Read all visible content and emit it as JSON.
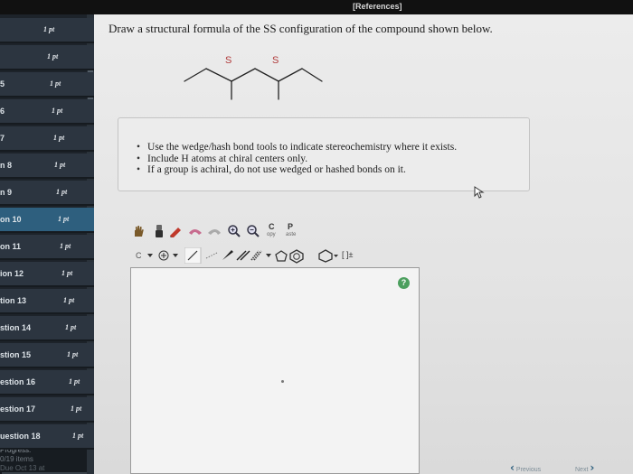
{
  "header": {
    "references_link": "[References]"
  },
  "sidebar": {
    "items": [
      {
        "label": "",
        "points": "1 pt"
      },
      {
        "label": "",
        "points": "1 pt"
      },
      {
        "label": "5",
        "points": "1 pt"
      },
      {
        "label": "6",
        "points": "1 pt"
      },
      {
        "label": "7",
        "points": "1 pt"
      },
      {
        "label": "n 8",
        "points": "1 pt"
      },
      {
        "label": "n 9",
        "points": "1 pt"
      },
      {
        "label": "on 10",
        "points": "1 pt"
      },
      {
        "label": "on 11",
        "points": "1 pt"
      },
      {
        "label": "ion 12",
        "points": "1 pt"
      },
      {
        "label": "tion 13",
        "points": "1 pt"
      },
      {
        "label": "stion 14",
        "points": "1 pt"
      },
      {
        "label": "stion 15",
        "points": "1 pt"
      },
      {
        "label": "estion 16",
        "points": "1 pt"
      },
      {
        "label": "estion 17",
        "points": "1 pt"
      },
      {
        "label": "uestion 18",
        "points": "1 pt"
      }
    ],
    "active_index": 7,
    "progress": {
      "title": "Progress:",
      "count": "0/19 items",
      "due": "Due Oct 13 at",
      "fraction": 0
    }
  },
  "question": {
    "title": "Draw a structural formula of the SS configuration of the compound shown below.",
    "stereo_label_1": "S",
    "stereo_label_2": "S",
    "instructions": [
      "Use the wedge/hash bond tools to indicate stereochemistry where it exists.",
      "Include H atoms at chiral centers only.",
      "If a group is achiral, do not use wedged or hashed bonds on it."
    ]
  },
  "toolbar": {
    "copy_label": "C",
    "copy_sub": "opy",
    "paste_label": "P",
    "paste_sub": "aste",
    "element_label": "C",
    "bracket_label": "[ ]±"
  },
  "nav": {
    "previous": "Previous",
    "next": "Next"
  },
  "colors": {
    "accent": "#2e5f7e",
    "sidebar_bg": "#1d232a",
    "help_green": "#4c9f5e"
  },
  "icons": [
    "hand-icon",
    "eraser-icon",
    "color-pencil-icon",
    "undo-icon",
    "redo-icon",
    "zoom-in-icon",
    "zoom-out-icon",
    "plus-charge-icon",
    "single-bond-icon",
    "chain-icon",
    "wedge-bond-icon",
    "hash-bond-icon",
    "double-bond-icon",
    "triple-bond-icon",
    "cyclopropane-icon",
    "benzene-icon",
    "cyclopentane-icon",
    "help-icon"
  ]
}
